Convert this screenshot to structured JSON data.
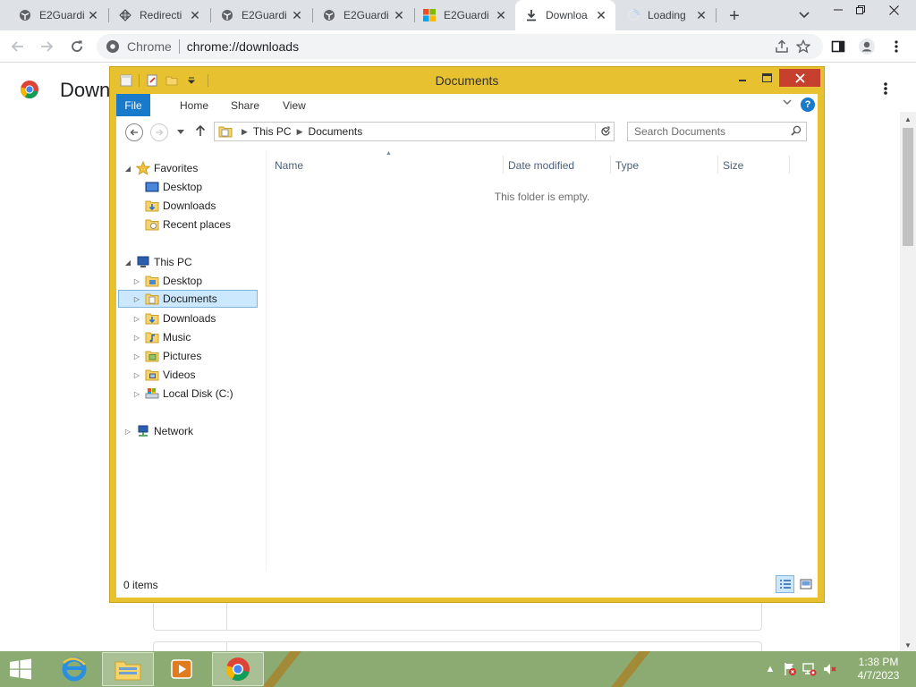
{
  "browser": {
    "tabs": [
      {
        "title": "E2Guardi",
        "icon": "globe-icon"
      },
      {
        "title": "Redirecti",
        "icon": "redirect-icon"
      },
      {
        "title": "E2Guardi",
        "icon": "globe-icon"
      },
      {
        "title": "E2Guardi",
        "icon": "globe-icon"
      },
      {
        "title": "E2Guardi",
        "icon": "microsoft-icon"
      },
      {
        "title": "Downloa",
        "icon": "download-icon",
        "active": true
      },
      {
        "title": "Loading",
        "icon": "loading-spinner-icon"
      }
    ],
    "new_tab_symbol": "+",
    "omnibox": {
      "chip": "Chrome",
      "url": "chrome://downloads"
    }
  },
  "downloads_page": {
    "title": "Downloads"
  },
  "explorer": {
    "title": "Documents",
    "ribbon_tabs": [
      "File",
      "Home",
      "Share",
      "View"
    ],
    "help_symbol": "?",
    "breadcrumb": [
      "This PC",
      "Documents"
    ],
    "search_placeholder": "Search Documents",
    "favorites": {
      "label": "Favorites",
      "items": [
        "Desktop",
        "Downloads",
        "Recent places"
      ]
    },
    "this_pc": {
      "label": "This PC",
      "items": [
        "Desktop",
        "Documents",
        "Downloads",
        "Music",
        "Pictures",
        "Videos",
        "Local Disk (C:)"
      ],
      "selected": "Documents"
    },
    "network": {
      "label": "Network"
    },
    "columns": [
      "Name",
      "Date modified",
      "Type",
      "Size"
    ],
    "empty_message": "This folder is empty.",
    "status": {
      "item_count": "0 items"
    }
  },
  "taskbar": {
    "apps": [
      "start-icon",
      "internet-explorer-icon",
      "file-explorer-icon",
      "media-player-icon",
      "chrome-icon"
    ],
    "clock": {
      "time": "1:38 PM",
      "date": "4/7/2023"
    }
  },
  "colors": {
    "explorer_frame": "#e7c12f",
    "ribbon_file_tab": "#1979ca",
    "selection": "#cce8ff",
    "taskbar": "#8cab72"
  }
}
